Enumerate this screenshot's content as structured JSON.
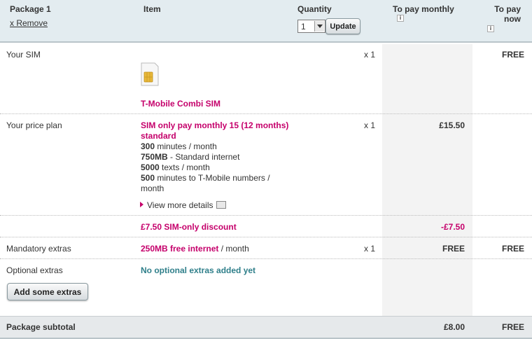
{
  "header": {
    "package_title": "Package 1",
    "remove_link": "x Remove",
    "item_label": "Item",
    "quantity_label": "Quantity",
    "quantity_value": "1",
    "update_button": "Update",
    "monthly_label": "To pay monthly",
    "now_label_1": "To pay",
    "now_label_2": "now",
    "info_glyph": "i"
  },
  "rows": {
    "sim": {
      "label": "Your SIM",
      "item_name": "T-Mobile Combi SIM",
      "qty": "x 1",
      "now": "FREE"
    },
    "plan": {
      "label": "Your price plan",
      "title_1": "SIM only pay monthly 15 (12 months)",
      "title_2": "standard",
      "f1_bold": "300",
      "f1_rest": "minutes / month",
      "f2_bold": "750MB",
      "f2_rest": "- Standard internet",
      "f3_bold": "5000",
      "f3_rest": "texts / month",
      "f4_bold": "500",
      "f4_rest": "minutes to T-Mobile numbers /",
      "f4_cont": "month",
      "view_more": "View more details",
      "qty": "x 1",
      "monthly": "£15.50"
    },
    "discount": {
      "name": "£7.50 SIM-only discount",
      "monthly": "-£7.50"
    },
    "mandatory": {
      "label": "Mandatory extras",
      "item_bold": "250MB free internet",
      "item_rest": "/ month",
      "qty": "x 1",
      "monthly": "FREE",
      "now": "FREE"
    },
    "optional": {
      "label": "Optional extras",
      "status": "No optional extras added yet",
      "button": "Add some extras"
    }
  },
  "footer": {
    "label": "Package subtotal",
    "monthly": "£8.00",
    "now": "FREE"
  }
}
